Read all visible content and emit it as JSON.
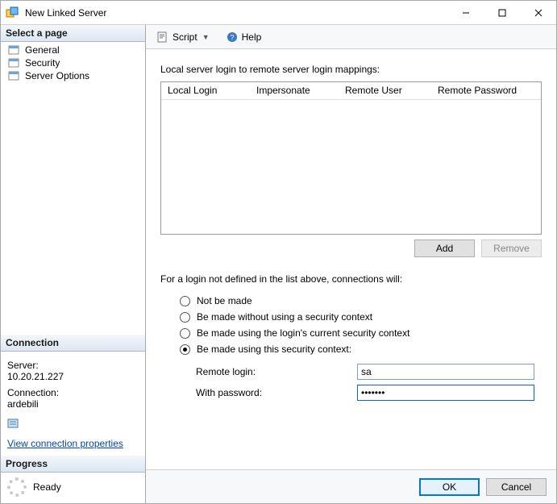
{
  "window": {
    "title": "New Linked Server"
  },
  "sidebar": {
    "select_page": "Select a page",
    "pages": {
      "general": "General",
      "security": "Security",
      "server_options": "Server Options"
    },
    "connection_heading": "Connection",
    "server_label": "Server:",
    "server_value": "10.20.21.227",
    "connection_label": "Connection:",
    "connection_value": "ardebili",
    "view_props_link": "View connection properties",
    "progress_heading": "Progress",
    "progress_status": "Ready"
  },
  "toolbar": {
    "script_label": "Script",
    "help_label": "Help"
  },
  "main": {
    "mapping_label": "Local server login to remote server login mappings:",
    "columns": {
      "local_login": "Local Login",
      "impersonate": "Impersonate",
      "remote_user": "Remote User",
      "remote_password": "Remote Password"
    },
    "add_btn": "Add",
    "remove_btn": "Remove",
    "undefined_prompt": "For a login not defined in the list above, connections will:",
    "radios": {
      "not_be_made": "Not be made",
      "without_security": "Be made without using a security context",
      "current_security": "Be made using the login's current security context",
      "this_security": "Be made using this security context:"
    },
    "remote_login_label": "Remote login:",
    "remote_login_value": "sa",
    "with_password_label": "With password:",
    "with_password_value": "•••••••"
  },
  "footer": {
    "ok": "OK",
    "cancel": "Cancel"
  }
}
